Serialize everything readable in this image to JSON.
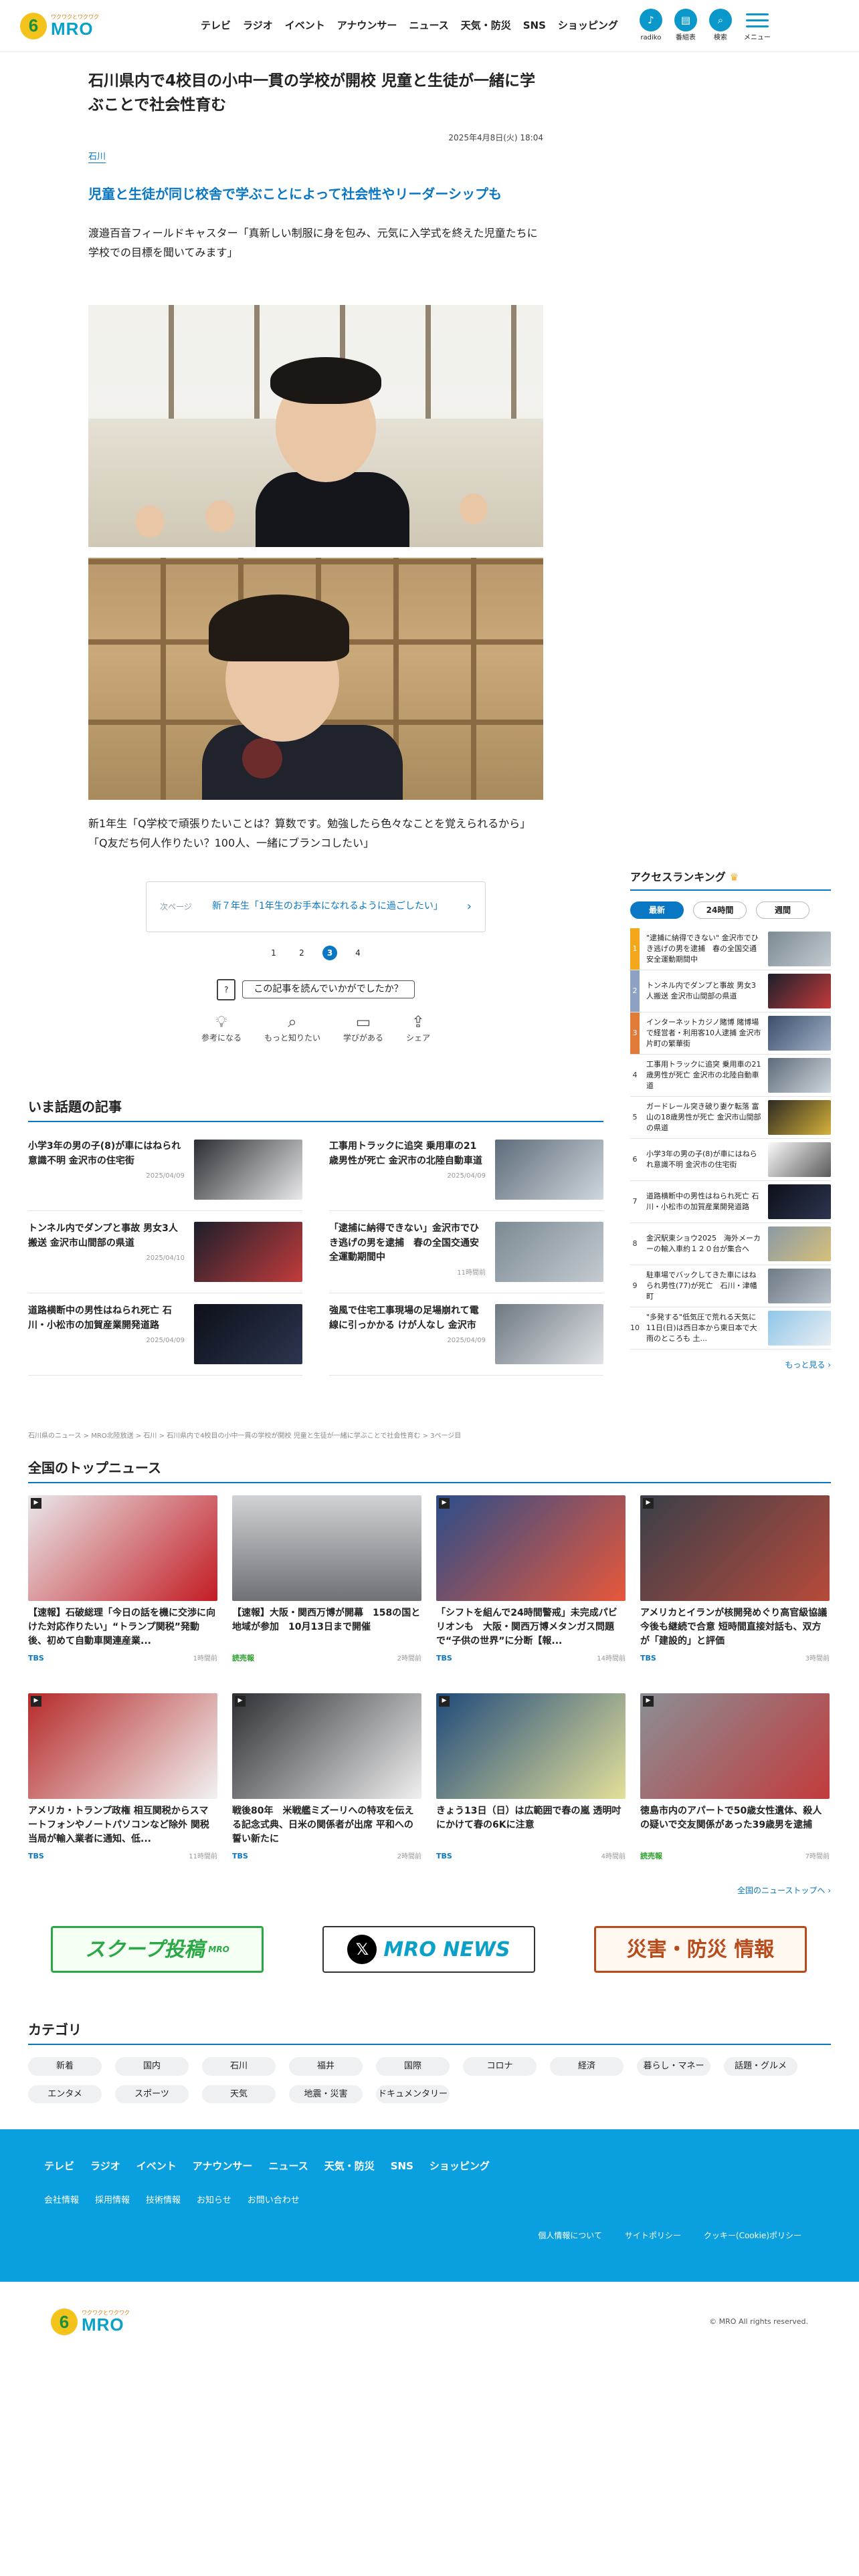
{
  "header": {
    "logo_sub": "ワクワクとワクワク",
    "logo_text": "MRO",
    "nav": [
      "テレビ",
      "ラジオ",
      "イベント",
      "アナウンサー",
      "ニュース",
      "天気・防災",
      "SNS",
      "ショッピング"
    ],
    "icons": [
      {
        "label": "radiko",
        "icon": "radio-icon"
      },
      {
        "label": "番組表",
        "icon": "schedule-icon"
      },
      {
        "label": "検索",
        "icon": "search-icon"
      },
      {
        "label": "メニュー",
        "icon": "menu-icon"
      }
    ]
  },
  "article": {
    "title": "石川県内で4校目の小中一貫の学校が開校 児童と生徒が一緒に学ぶことで社会性育む",
    "date": "2025年4月8日(火) 18:04",
    "pref": "石川",
    "lead": "児童と生徒が同じ校舎で学ぶことによって社会性やリーダーシップも",
    "para": "渡邉百音フィールドキャスター「真新しい制服に身を包み、元気に入学式を終えた児童たちに学校での目標を聞いてみます」",
    "caption": "新1年生「Q学校で頑張りたいことは？算数です。勉強したら色々なことを覚えられるから」「Q友だち何人作りたい？100人、一緒にブランコしたい」",
    "next_label": "次ページ",
    "next_text": "新７年生「1年生のお手本になれるように過ごしたい」",
    "pages": [
      "1",
      "2",
      "3",
      "4"
    ],
    "current_page": "3",
    "feedback_question": "この記事を読んでいかがでしたか？",
    "feedback_items": [
      {
        "label": "参考になる",
        "icon": "lightbulb-icon"
      },
      {
        "label": "もっと知りたい",
        "icon": "search-icon"
      },
      {
        "label": "学びがある",
        "icon": "book-icon"
      },
      {
        "label": "シェア",
        "icon": "share-icon"
      }
    ]
  },
  "ranking": {
    "title": "アクセスランキング",
    "tabs": [
      "最新",
      "24時間",
      "週間"
    ],
    "items": [
      {
        "num": "1",
        "text": "\"逮捕に納得できない\" 金沢市でひき逃げの男を逮捕　春の全国交通安全運動期間中"
      },
      {
        "num": "2",
        "text": "トンネル内でダンプと事故 男女3人搬送 金沢市山間部の県道"
      },
      {
        "num": "3",
        "text": "インターネットカジノ賭博 賭博場で経営者・利用客10人逮捕 金沢市片町の繁華街"
      },
      {
        "num": "4",
        "text": "工事用トラックに追突 乗用車の21歳男性が死亡 金沢市の北陸自動車道"
      },
      {
        "num": "5",
        "text": "ガードレール突き破り妻ケ転落 富山の18歳男性が死亡 金沢市山間部の県道"
      },
      {
        "num": "6",
        "text": "小学3年の男の子(8)が車にはねられ意識不明 金沢市の住宅街"
      },
      {
        "num": "7",
        "text": "道路横断中の男性はねられ死亡 石川・小松市の加賀産業開発道路"
      },
      {
        "num": "8",
        "text": "金沢駅東ショウ2025　海外メーカーの輸入車約１２０台が集合へ"
      },
      {
        "num": "9",
        "text": "駐車場でバックしてきた車にはねられ男性(77)が死亡　石川・津幡町"
      },
      {
        "num": "10",
        "text": "\"多発する\"低気圧で荒れる天気に 11日(日)は西日本から東日本で大雨のところも 土..."
      }
    ],
    "more": "もっと見る"
  },
  "topics": {
    "title": "いま話題の記事",
    "items": [
      {
        "title": "小学3年の男の子(8)が車にはねられ意識不明 金沢市の住宅街",
        "date": "2025/04/09"
      },
      {
        "title": "工事用トラックに追突 乗用車の21歳男性が死亡 金沢市の北陸自動車道",
        "date": "2025/04/09"
      },
      {
        "title": "トンネル内でダンプと事故 男女3人搬送 金沢市山間部の県道",
        "date": "2025/04/10"
      },
      {
        "title": "「逮捕に納得できない」金沢市でひき逃げの男を逮捕　春の全国交通安全運動期間中",
        "date": "11時間前"
      },
      {
        "title": "道路横断中の男性はねられ死亡 石川・小松市の加賀産業開発道路",
        "date": "2025/04/09"
      },
      {
        "title": "強風で住宅工事現場の足場崩れて電線に引っかかる けが人なし 金沢市",
        "date": "2025/04/09"
      }
    ]
  },
  "breadcrumb": "石川県のニュース > MRO北陸放送 > 石川 > 石川県内で4校目の小中一貫の学校が開校 児童と生徒が一緒に学ぶことで社会性育む > 3ページ目",
  "national": {
    "title": "全国のトップニュース",
    "items": [
      {
        "title": "【速報】石破総理「今日の話を機に交渉に向けた対応作りたい」“トランプ関税”発動後、初めて自動車関連産業...",
        "src": "TBS",
        "time": "1時間前"
      },
      {
        "title": "【速報】大阪・関西万博が開幕　158の国と地域が参加　10月13日まで開催",
        "src": "読売報",
        "time": "2時間前"
      },
      {
        "title": "「シフトを組んで24時間警戒」未完成パビリオンも　大阪・関西万博メタンガス問題で“子供の世界”に分断【報...",
        "src": "TBS",
        "time": "14時間前"
      },
      {
        "title": "アメリカとイランが核開発めぐり高官級協議 今後も継続で合意 短時間直接対話も、双方が「建設的」と評価",
        "src": "TBS",
        "time": "3時間前"
      },
      {
        "title": "アメリカ・トランプ政権 相互関税からスマートフォンやノートパソコンなど除外 関税当局が輸入業者に通知、低...",
        "src": "TBS",
        "time": "11時間前"
      },
      {
        "title": "戦後80年　米戦艦ミズーリへの特攻を伝える記念式典、日米の関係者が出席 平和への誓い新たに",
        "src": "TBS",
        "time": "2時間前"
      },
      {
        "title": "きょう13日（日）は広範囲で春の嵐 透明吋にかけて春の6Kに注意",
        "src": "TBS",
        "time": "4時間前"
      },
      {
        "title": "徳島市内のアパートで50歳女性遺体、殺人の疑いで交友関係があった39歳男を逮捕",
        "src": "読売報",
        "time": "7時間前"
      }
    ],
    "more": "全国のニューストップへ"
  },
  "banners": [
    {
      "label": "スクープ投稿",
      "sub": "MRO"
    },
    {
      "label": "MRO NEWS",
      "icon": "x-icon"
    },
    {
      "label": "災害・防災 情報"
    }
  ],
  "category": {
    "title": "カテゴリ",
    "chips": [
      "新着",
      "国内",
      "石川",
      "福井",
      "国際",
      "コロナ",
      "経済",
      "暮らし・マネー",
      "話題・グルメ",
      "エンタメ",
      "スポーツ",
      "天気",
      "地震・災害",
      "ドキュメンタリー"
    ]
  },
  "footer": {
    "nav1": [
      "テレビ",
      "ラジオ",
      "イベント",
      "アナウンサー",
      "ニュース",
      "天気・防災",
      "SNS",
      "ショッピング"
    ],
    "nav2": [
      "会社情報",
      "採用情報",
      "技術情報",
      "お知らせ",
      "お問い合わせ"
    ],
    "nav3": [
      "個人情報について",
      "サイトポリシー",
      "クッキー(Cookie)ポリシー"
    ],
    "copyright": "© MRO All rights reserved."
  },
  "colors": {
    "accent": "#0a77c4",
    "footer": "#0aa0e0",
    "brand_yellow": "#f3c31c"
  }
}
